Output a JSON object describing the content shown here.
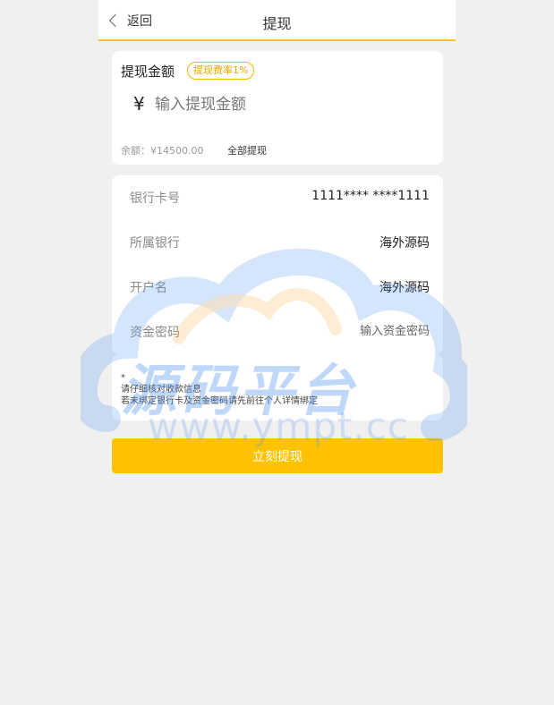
{
  "header": {
    "back_label": "返回",
    "title": "提现"
  },
  "amount_card": {
    "label": "提现金额",
    "fee_badge": "提现费率1%",
    "currency_symbol": "¥",
    "amount_placeholder": "输入提现金额",
    "balance_text": "余额：¥14500.00",
    "withdraw_all_label": "全部提现"
  },
  "bank_card": {
    "rows": [
      {
        "label": "银行卡号",
        "value": "1111**** ****1111"
      },
      {
        "label": "所属银行",
        "value": "海外源码"
      },
      {
        "label": "开户名",
        "value": "海外源码"
      }
    ],
    "password_label": "资金密码",
    "password_placeholder": "输入资金密码"
  },
  "notes": {
    "lines": [
      "*",
      "请仔细核对收款信息",
      "若未绑定银行卡及资金密码请先前往个人详情绑定"
    ]
  },
  "submit_label": "立刻提现",
  "watermark": {
    "text": "源码平台",
    "url": "www.ympt.cc"
  },
  "colors": {
    "accent": "#ffc200",
    "badge_border": "#f5b800",
    "background": "#f0f0f0",
    "watermark_blue": "#4a8ef0",
    "watermark_orange": "#f7b24a"
  }
}
